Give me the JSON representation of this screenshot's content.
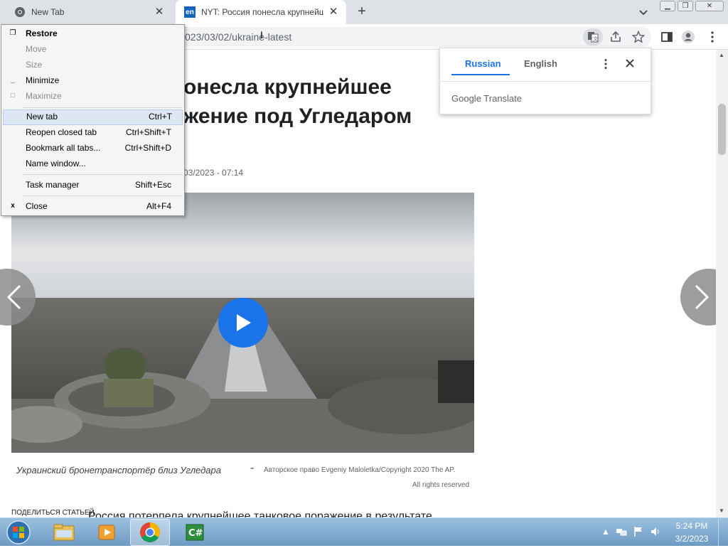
{
  "browser": {
    "tabs": [
      {
        "title": "New Tab",
        "favicon": "chrome-icon"
      },
      {
        "title": "NYT: Россия понесла крупнейш",
        "favicon_text": "en"
      }
    ],
    "url_partial": "023/03/02/ukraine-latest"
  },
  "translate": {
    "tab_source": "Russian",
    "tab_target": "English",
    "brand": "Google Translate"
  },
  "system_menu": {
    "items": [
      {
        "label": "Restore",
        "shortcut": "",
        "icon": "restore"
      },
      {
        "label": "Move",
        "shortcut": "",
        "icon": ""
      },
      {
        "label": "Size",
        "shortcut": "",
        "icon": ""
      },
      {
        "label": "Minimize",
        "shortcut": "",
        "icon": "minimize"
      },
      {
        "label": "Maximize",
        "shortcut": "",
        "icon": "maximize"
      },
      {
        "label": "New tab",
        "shortcut": "Ctrl+T",
        "icon": ""
      },
      {
        "label": "Reopen closed tab",
        "shortcut": "Ctrl+Shift+T",
        "icon": ""
      },
      {
        "label": "Bookmark all tabs...",
        "shortcut": "Ctrl+Shift+D",
        "icon": ""
      },
      {
        "label": "Name window...",
        "shortcut": "",
        "icon": ""
      },
      {
        "label": "Task manager",
        "shortcut": "Shift+Esc",
        "icon": ""
      },
      {
        "label": "Close",
        "shortcut": "Alt+F4",
        "icon": "x"
      }
    ]
  },
  "article": {
    "headline_line1": "онесла крупнейшее",
    "headline_line2": "жение под Угледаром",
    "dateline": "03/2023 - 07:14",
    "caption": "Украинский бронетранспортёр близ Угледара",
    "caption_dash": "-",
    "credit_line1": "Авторское право  Evgeniy Maloletka/Copyright 2020 The AP.",
    "credit_line2": "All rights reserved",
    "share_label": "ПОДЕЛИТЬСЯ СТАТЬЕЙ",
    "body_start": "Россия потерпела крупнейшее танковое поражение в результате"
  },
  "taskbar": {
    "clock_time": "5:24 PM",
    "clock_date": "3/2/2023"
  },
  "colors": {
    "accent": "#1a73e8",
    "menu_highlight": "#dde6f3"
  }
}
